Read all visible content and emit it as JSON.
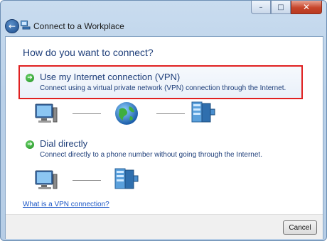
{
  "window": {
    "title": "Connect to a Workplace",
    "caption_buttons": {
      "minimize": "–",
      "maximize": "□",
      "close": "✕"
    },
    "back_glyph": "←"
  },
  "main": {
    "heading": "How do you want to connect?",
    "options": [
      {
        "title": "Use my Internet connection (VPN)",
        "description": "Connect using a virtual private network (VPN) connection through the Internet.",
        "diagram_icons": [
          "computer-icon",
          "globe-icon",
          "server-icon"
        ],
        "highlighted": true
      },
      {
        "title": "Dial directly",
        "description": "Connect directly to a phone number without going through the Internet.",
        "diagram_icons": [
          "computer-icon",
          "server-icon"
        ],
        "highlighted": false
      }
    ],
    "help_link": "What is a VPN connection?"
  },
  "footer": {
    "cancel_label": "Cancel"
  },
  "colors": {
    "heading_text": "#1f3f7a",
    "highlight_border": "#e02020",
    "link": "#1a56c6"
  }
}
